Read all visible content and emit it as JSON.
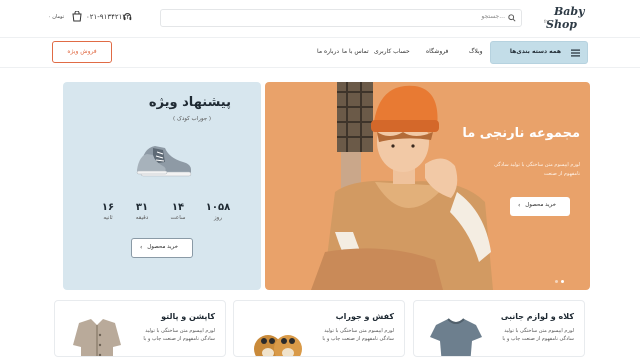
{
  "header": {
    "logo_line1": "Baby",
    "logo_line2": "Shop",
    "logo_tm": "fm",
    "search_placeholder": "جستجو...",
    "phone": "۰۲۱-۹۱۳۴۲۱۲۳",
    "cart_amount": "۰ تومان"
  },
  "nav": {
    "category_button": "همه دسته بندی‌ها",
    "items": [
      "وبلاگ",
      "فروشگاه",
      "حساب کاربری",
      "تماس با ما",
      "درباره ما"
    ],
    "seller_button": "فروش ویژه"
  },
  "hero": {
    "title": "مجموعه نارنجی ما",
    "description": "لورم ایپسوم متن ساختگی با تولید سادگی نامفهوم از صنعت",
    "button": "خرید محصول",
    "slides": 2,
    "active_slide": 1
  },
  "offer": {
    "title": "پیشنهاد ویژه",
    "subtitle": "( جوراب کودک )",
    "countdown": [
      {
        "value": "۱۰۵۸",
        "unit": "روز"
      },
      {
        "value": "۱۴",
        "unit": "ساعت"
      },
      {
        "value": "۳۱",
        "unit": "دقیقه"
      },
      {
        "value": "۱۶",
        "unit": "ثانیه"
      }
    ],
    "button": "خرید محصول"
  },
  "cards": [
    {
      "title": "کلاه و لوازم جانبی",
      "desc": "لورم ایپسوم متن ساختگی با تولید سادگی نامفهوم از صنعت چاپ و با"
    },
    {
      "title": "کفش و جوراب",
      "desc": "لورم ایپسوم متن ساختگی با تولید سادگی نامفهوم از صنعت چاپ و با"
    },
    {
      "title": "کاپشن و پالتو",
      "desc": "لورم ایپسوم متن ساختگی با تولید سادگی نامفهوم از صنعت چاپ و با"
    }
  ],
  "colors": {
    "accent": "#e06b45",
    "hero_bg": "#e9a26a",
    "offer_bg": "#d7e6ee",
    "category_button_bg": "#c3dde8"
  }
}
